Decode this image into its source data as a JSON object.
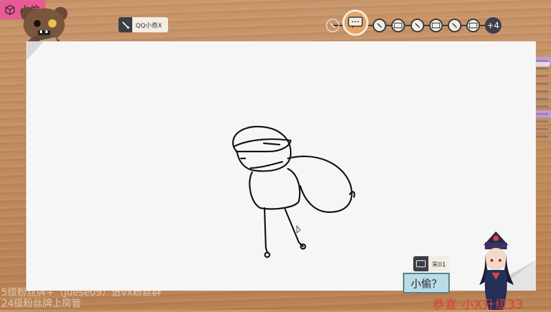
{
  "drawer": {
    "name": "QQ小奇X",
    "brush_icon": "brush-icon"
  },
  "word_chip": {
    "label": "小偷",
    "icon": "box-icon"
  },
  "turns": {
    "more_count": "+4"
  },
  "guess": {
    "user": "宋01",
    "text": "小偷？",
    "icon": "chat-bubble-icon"
  },
  "overlay": {
    "line1": "5级粉丝牌+（Juese09）进vx粉丝群",
    "line2": "24级粉丝牌上房管",
    "congrats": "恭喜 小X升级33"
  },
  "colors": {
    "word_chip": "#e85a95",
    "guess_bubble": "#b8dde6",
    "congrats": "#e03a3a",
    "wood": "#c08a5a"
  }
}
